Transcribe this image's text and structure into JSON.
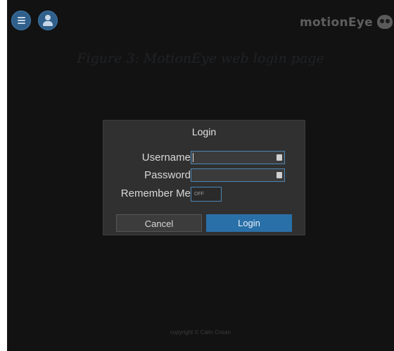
{
  "header": {
    "brand": "motionEye",
    "menu_icon": "menu-icon",
    "user_icon": "user-icon",
    "logo_icon": "motioneye-logo-icon"
  },
  "caption": "Figure 3: MotionEye web login page",
  "login_dialog": {
    "title": "Login",
    "username_label": "Username",
    "username_value": "",
    "password_label": "Password",
    "password_value": "",
    "remember_label": "Remember Me",
    "remember_state": "OFF",
    "cancel_label": "Cancel",
    "login_label": "Login"
  },
  "footer": {
    "copyright": "copyright © Calin Crisan"
  },
  "colors": {
    "background": "#121212",
    "dialog": "#303030",
    "accent": "#2a70a8",
    "field_border": "#4e86b5"
  }
}
